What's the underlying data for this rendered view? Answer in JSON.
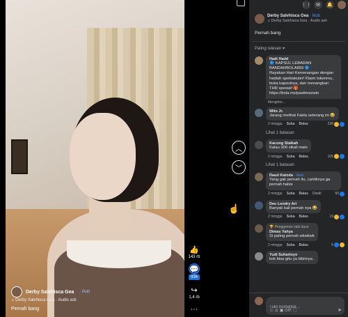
{
  "video": {
    "author": "Derby Salvhisca Gea",
    "follow": "· Ikuti",
    "audio": "♫ Derby Salvhisca Gea · Audio asli",
    "caption": "Pernah bang"
  },
  "actions": {
    "like_count": "143 rb",
    "comment_count": "936",
    "share_count": "1,4 rb",
    "more": "···"
  },
  "panel": {
    "author": "Derby Salvhisca Gea",
    "follow": "· Ikuti",
    "audio": "♫ Derby Salvhisca Gea · Audio asli",
    "caption": "Pernah bang",
    "sort_label": "Paling relevan"
  },
  "comments": [
    {
      "name": "Hadi Hadd",
      "text": "🔷 KAPSUL LEBARAN BANDARBOLA855 🔷\nRayakan Hari Kemenangan dengan hadiah spektakuler! Klaim tokenmu, buka kapsulnya, dan menangkan THR spesial! 🎁\nhttps://bola.mx/pastimaxwin",
      "extra": "Mengirim...",
      "time": "",
      "reactions": ""
    },
    {
      "name": "Wito Jr.",
      "text": "Jarang melihat Fakta seterang ini 😂",
      "time": "2 minggu",
      "like": "Suka",
      "reply": "Balas",
      "reactions": "238",
      "replies": "Lihat 1 balasan"
    },
    {
      "name": "Kacong Stalkah",
      "text": "Kalau 300 sikali main",
      "time": "2 minggu",
      "like": "Suka",
      "reply": "Balas",
      "reactions": "105",
      "replies": "Lihat 1 balasan"
    },
    {
      "name": "Daud Katoda",
      "follow": "· Ikuti",
      "text": "Yang gak pernah itu, cantiknya ga pernah habis",
      "time": "2 minggu",
      "like": "Suka",
      "reply": "Balas",
      "edited": "Diedit",
      "reactions": "60"
    },
    {
      "name": "Dee Londry Ari",
      "text": "Banyak kali pernah nya 😂",
      "time": "2 minggu",
      "like": "Suka",
      "reply": "Balas",
      "reactions": "19"
    },
    {
      "badge": "🏆 Penggemar naik daun",
      "name": "Dimas Yahya",
      "text": "Si paling pernah wkwkwk",
      "time": "2 minggu",
      "like": "Suka",
      "reply": "Balas",
      "reactions": "5"
    },
    {
      "name": "Yudi Suhartoyo",
      "text": "kok bisa gitu ya bibirnya.."
    }
  ],
  "composer": {
    "placeholder": "Tulis komentar...",
    "tools": "☺  ◎  ▣  GIF  ⬚"
  },
  "icons": {
    "like": "thumbs-up",
    "comment": "speech-bubble",
    "share": "share-arrow",
    "up": "chevron-up",
    "down": "chevron-down"
  }
}
